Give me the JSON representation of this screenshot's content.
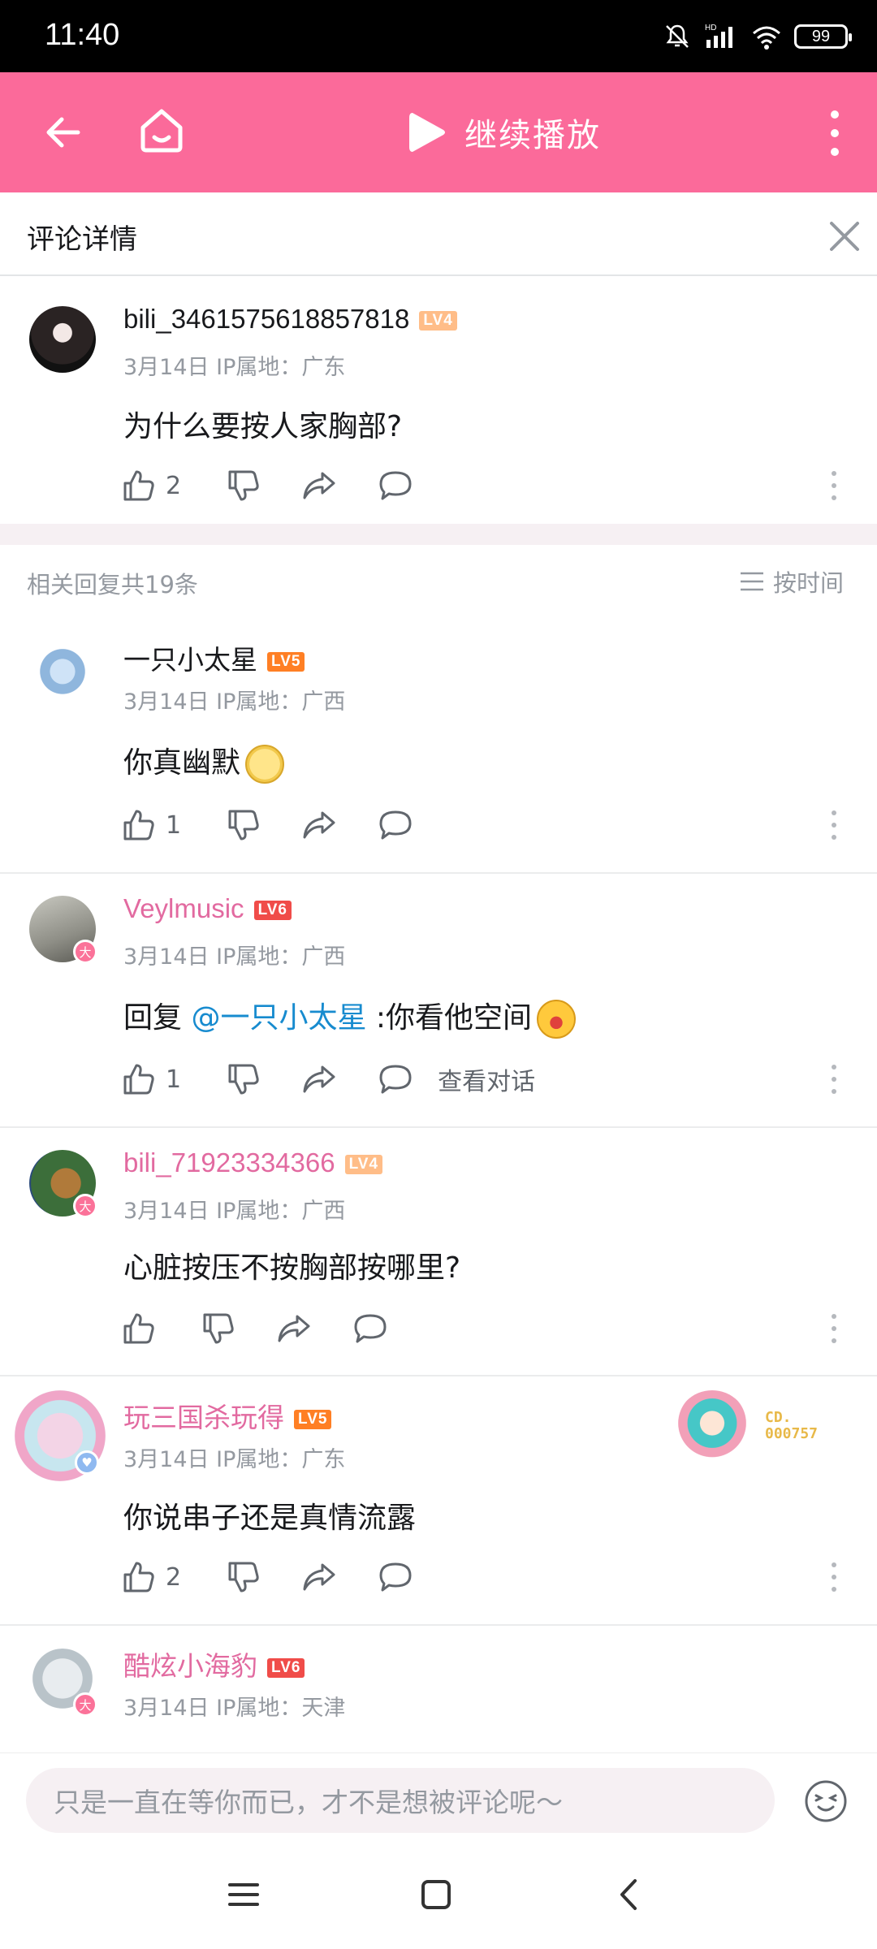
{
  "status_bar": {
    "time": "11:40",
    "battery": "99",
    "network": "HD"
  },
  "app_bar": {
    "play_label": "继续播放"
  },
  "detail": {
    "title": "评论详情"
  },
  "root_comment": {
    "username": "bili_3461575618857818",
    "level": "LV4",
    "meta": "3月14日 IP属地：广东",
    "content": "为什么要按人家胸部?",
    "likes": "2"
  },
  "replies_header": {
    "count_text": "相关回复共19条",
    "sort_label": "按时间"
  },
  "replies": [
    {
      "username": "一只小太星",
      "level": "LV5",
      "meta": "3月14日 IP属地：广西",
      "content": "你真幽默",
      "likes": "1"
    },
    {
      "username": "Veylmusic",
      "level": "LV6",
      "meta": "3月14日 IP属地：广西",
      "reply_prefix": "回复 ",
      "mention": "@一只小太星",
      "content": " :你看他空间",
      "likes": "1",
      "view_conversation": "查看对话"
    },
    {
      "username": "bili_71923334366",
      "level": "LV4",
      "meta": "3月14日 IP属地：广西",
      "content": "心脏按压不按胸部按哪里?",
      "likes": ""
    },
    {
      "username": "玩三国杀玩得",
      "level": "LV5",
      "meta": "3月14日 IP属地：广东",
      "content": "你说串子还是真情流露",
      "likes": "2",
      "fan_badge": "CD.\n000757"
    },
    {
      "username": "酷炫小海豹",
      "level": "LV6",
      "meta": "3月14日 IP属地：天津",
      "content": "",
      "likes": ""
    }
  ],
  "input": {
    "placeholder": "只是一直在等你而已，才不是想被评论呢～"
  },
  "colors": {
    "brand_pink": "#fb6a9a",
    "vip_name": "#e26aa0",
    "mention": "#178bcf"
  },
  "icons": [
    "back-arrow-icon",
    "home-icon",
    "play-icon",
    "more-vertical-icon",
    "close-icon",
    "thumb-up-icon",
    "thumb-down-icon",
    "share-icon",
    "comment-icon",
    "sort-icon",
    "emoji-icon",
    "menu-icon",
    "square-icon",
    "back-chevron-icon"
  ]
}
